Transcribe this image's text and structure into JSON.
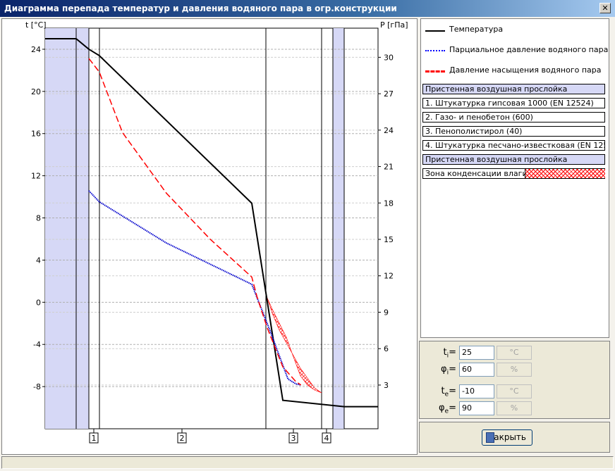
{
  "window": {
    "title": "Диаграмма перепада температур и давления водяного пара в огр.конструкции",
    "close_glyph": "✕"
  },
  "legend": {
    "items": [
      {
        "label": "Температура",
        "color": "#000000",
        "style": "solid"
      },
      {
        "label": "Парциальное давление водяного пара",
        "color": "#0000ff",
        "style": "dotted"
      },
      {
        "label": "Давление насыщения водяного пара",
        "color": "#ff0000",
        "style": "dashed"
      }
    ],
    "layers": [
      {
        "label": "Пристенная воздушная прослойка",
        "air": true
      },
      {
        "label": "1. Штукатурка гипсовая 1000 (EN 12524)",
        "air": false
      },
      {
        "label": "2. Газо- и пенобетон (600)",
        "air": false
      },
      {
        "label": "3. Пенополистирол (40)",
        "air": false
      },
      {
        "label": "4. Штукатурка песчано-известковая (EN 12524)",
        "air": false
      },
      {
        "label": "Пристенная воздушная прослойка",
        "air": true
      }
    ],
    "condensation_label": "Зона конденсации влаги ->"
  },
  "params": {
    "ti": {
      "sym": "t",
      "sub": "i",
      "value": "25",
      "unit": "°C"
    },
    "phii": {
      "sym": "φ",
      "sub": "i",
      "value": "60",
      "unit": "%"
    },
    "te": {
      "sym": "t",
      "sub": "e",
      "value": "-10",
      "unit": "°C"
    },
    "phie": {
      "sym": "φ",
      "sub": "e",
      "value": "90",
      "unit": "%"
    }
  },
  "close_button": {
    "label": "Закрыть",
    "icon": "door-icon"
  },
  "chart_data": {
    "type": "line",
    "left_axis": {
      "label": "t [°C]",
      "ticks": [
        24,
        20,
        16,
        12,
        8,
        4,
        0,
        -4,
        -8
      ],
      "range": [
        -12,
        26
      ]
    },
    "right_axis": {
      "label": "P [гПа]",
      "ticks": [
        30,
        27,
        24,
        21,
        18,
        15,
        12,
        9,
        6,
        3
      ],
      "range": [
        0,
        33
      ]
    },
    "layer_labels": [
      "1",
      "2",
      "3",
      "4"
    ],
    "series": [
      {
        "name": "Температура",
        "axis": "left",
        "color": "#000000",
        "points": [
          [
            0,
            25
          ],
          [
            0.11,
            25
          ],
          [
            0.15,
            24
          ],
          [
            0.19,
            23.4
          ],
          [
            0.78,
            9.4
          ],
          [
            0.9,
            -9.3
          ],
          [
            1.0,
            -9.9
          ],
          [
            1.15,
            -9.9
          ]
        ]
      },
      {
        "name": "Парциальное давление водяного пара",
        "axis": "right",
        "color": "#0000cc",
        "points": [
          [
            0.15,
            19
          ],
          [
            0.19,
            18.1
          ],
          [
            0.45,
            14.7
          ],
          [
            0.78,
            11.3
          ],
          [
            0.85,
            7.5
          ],
          [
            0.92,
            3.5
          ],
          [
            0.95,
            3.1
          ],
          [
            0.97,
            3.0
          ]
        ]
      },
      {
        "name": "Давление насыщения водяного пара",
        "axis": "right",
        "color": "#ff0000",
        "points": [
          [
            0.15,
            29.9
          ],
          [
            0.19,
            28.8
          ],
          [
            0.28,
            23.8
          ],
          [
            0.45,
            18.8
          ],
          [
            0.62,
            15
          ],
          [
            0.78,
            11.9
          ],
          [
            0.8,
            10.3
          ],
          [
            0.84,
            7.7
          ],
          [
            0.9,
            4.5
          ],
          [
            0.95,
            3.3
          ],
          [
            0.97,
            3.0
          ]
        ]
      }
    ]
  }
}
